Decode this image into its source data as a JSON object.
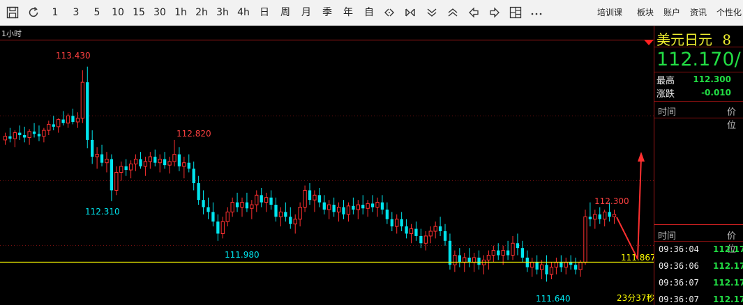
{
  "toolbar": {
    "icons": [
      "chart-save-icon",
      "refresh-icon"
    ],
    "periods": [
      "1",
      "3",
      "5",
      "10",
      "15",
      "30",
      "1h",
      "2h",
      "3h",
      "4h",
      "日",
      "周",
      "月",
      "季",
      "年",
      "自"
    ],
    "right_menu": [
      "培训课",
      "板块",
      "账户",
      "资讯",
      "个性化"
    ]
  },
  "chart": {
    "period_label": "1小时",
    "labels": {
      "high_main": "113.430",
      "high_2": "112.820",
      "low_1": "112.310",
      "low_2": "111.980",
      "recent_high": "112.300",
      "bottom_low": "111.640",
      "current_price": "111.867",
      "countdown": "23分37秒"
    },
    "colors": {
      "up": "#ff3030",
      "down": "#00e5ee",
      "current_line": "#ffff00",
      "grid": "#7a1010"
    }
  },
  "chart_data": {
    "type": "candlestick",
    "title": "",
    "period": "1小时",
    "annotations": [
      {
        "label": "113.430",
        "kind": "high"
      },
      {
        "label": "112.820",
        "kind": "high"
      },
      {
        "label": "112.310",
        "kind": "low"
      },
      {
        "label": "111.980",
        "kind": "low"
      },
      {
        "label": "112.300",
        "kind": "high"
      },
      {
        "label": "111.640",
        "kind": "low"
      }
    ],
    "ylim": [
      111.55,
      113.55
    ],
    "current_price": 111.867,
    "candles": [
      [
        112.82,
        112.88,
        112.78,
        112.85
      ],
      [
        112.85,
        112.92,
        112.8,
        112.83
      ],
      [
        112.83,
        112.9,
        112.76,
        112.88
      ],
      [
        112.88,
        112.94,
        112.82,
        112.86
      ],
      [
        112.86,
        112.93,
        112.8,
        112.84
      ],
      [
        112.84,
        112.91,
        112.78,
        112.89
      ],
      [
        112.89,
        112.96,
        112.84,
        112.87
      ],
      [
        112.87,
        112.94,
        112.81,
        112.85
      ],
      [
        112.85,
        112.92,
        112.8,
        112.9
      ],
      [
        112.9,
        112.98,
        112.86,
        112.95
      ],
      [
        112.95,
        113.02,
        112.9,
        112.93
      ],
      [
        112.93,
        113.0,
        112.88,
        112.99
      ],
      [
        112.99,
        113.06,
        112.94,
        112.96
      ],
      [
        112.96,
        113.04,
        112.92,
        113.02
      ],
      [
        113.02,
        113.08,
        112.95,
        112.97
      ],
      [
        112.97,
        113.05,
        112.92,
        113.0
      ],
      [
        113.0,
        113.4,
        112.96,
        113.3
      ],
      [
        113.3,
        113.43,
        112.75,
        112.82
      ],
      [
        112.82,
        112.9,
        112.62,
        112.68
      ],
      [
        112.68,
        112.76,
        112.58,
        112.7
      ],
      [
        112.7,
        112.78,
        112.6,
        112.63
      ],
      [
        112.63,
        112.72,
        112.55,
        112.66
      ],
      [
        112.66,
        112.7,
        112.31,
        112.4
      ],
      [
        112.4,
        112.6,
        112.36,
        112.55
      ],
      [
        112.55,
        112.64,
        112.48,
        112.6
      ],
      [
        112.6,
        112.66,
        112.52,
        112.57
      ],
      [
        112.57,
        112.65,
        112.5,
        112.62
      ],
      [
        112.62,
        112.7,
        112.56,
        112.66
      ],
      [
        112.66,
        112.72,
        112.58,
        112.6
      ],
      [
        112.6,
        112.68,
        112.52,
        112.64
      ],
      [
        112.64,
        112.72,
        112.58,
        112.68
      ],
      [
        112.68,
        112.74,
        112.6,
        112.63
      ],
      [
        112.63,
        112.7,
        112.55,
        112.66
      ],
      [
        112.66,
        112.72,
        112.58,
        112.61
      ],
      [
        112.61,
        112.68,
        112.54,
        112.64
      ],
      [
        112.64,
        112.82,
        112.6,
        112.7
      ],
      [
        112.7,
        112.76,
        112.56,
        112.6
      ],
      [
        112.6,
        112.68,
        112.5,
        112.63
      ],
      [
        112.63,
        112.7,
        112.55,
        112.58
      ],
      [
        112.58,
        112.64,
        112.4,
        112.46
      ],
      [
        112.46,
        112.52,
        112.28,
        112.32
      ],
      [
        112.32,
        112.4,
        112.2,
        112.26
      ],
      [
        112.26,
        112.34,
        112.16,
        112.22
      ],
      [
        112.22,
        112.3,
        112.1,
        112.14
      ],
      [
        112.14,
        112.2,
        111.98,
        112.04
      ],
      [
        112.04,
        112.18,
        112.0,
        112.14
      ],
      [
        112.14,
        112.26,
        112.1,
        112.22
      ],
      [
        112.22,
        112.34,
        112.18,
        112.3
      ],
      [
        112.3,
        112.38,
        112.22,
        112.26
      ],
      [
        112.26,
        112.34,
        112.18,
        112.3
      ],
      [
        112.3,
        112.38,
        112.22,
        112.25
      ],
      [
        112.25,
        112.32,
        112.16,
        112.28
      ],
      [
        112.28,
        112.4,
        112.22,
        112.36
      ],
      [
        112.36,
        112.42,
        112.26,
        112.3
      ],
      [
        112.3,
        112.38,
        112.22,
        112.34
      ],
      [
        112.34,
        112.4,
        112.24,
        112.28
      ],
      [
        112.28,
        112.34,
        112.14,
        112.18
      ],
      [
        112.18,
        112.26,
        112.1,
        112.22
      ],
      [
        112.22,
        112.3,
        112.14,
        112.18
      ],
      [
        112.18,
        112.26,
        112.08,
        112.12
      ],
      [
        112.12,
        112.2,
        112.04,
        112.16
      ],
      [
        112.16,
        112.3,
        112.1,
        112.26
      ],
      [
        112.26,
        112.44,
        112.22,
        112.4
      ],
      [
        112.4,
        112.46,
        112.28,
        112.32
      ],
      [
        112.32,
        112.4,
        112.22,
        112.36
      ],
      [
        112.36,
        112.42,
        112.26,
        112.3
      ],
      [
        112.3,
        112.36,
        112.2,
        112.24
      ],
      [
        112.24,
        112.32,
        112.16,
        112.28
      ],
      [
        112.28,
        112.34,
        112.18,
        112.22
      ],
      [
        112.22,
        112.3,
        112.14,
        112.26
      ],
      [
        112.26,
        112.32,
        112.16,
        112.2
      ],
      [
        112.2,
        112.3,
        112.14,
        112.27
      ],
      [
        112.27,
        112.34,
        112.2,
        112.24
      ],
      [
        112.24,
        112.32,
        112.16,
        112.28
      ],
      [
        112.28,
        112.36,
        112.2,
        112.25
      ],
      [
        112.25,
        112.32,
        112.18,
        112.29
      ],
      [
        112.29,
        112.36,
        112.22,
        112.26
      ],
      [
        112.26,
        112.34,
        112.18,
        112.3
      ],
      [
        112.3,
        112.36,
        112.2,
        112.24
      ],
      [
        112.24,
        112.3,
        112.12,
        112.16
      ],
      [
        112.16,
        112.22,
        112.06,
        112.1
      ],
      [
        112.1,
        112.2,
        112.04,
        112.16
      ],
      [
        112.16,
        112.22,
        112.06,
        112.1
      ],
      [
        112.1,
        112.16,
        112.0,
        112.04
      ],
      [
        112.04,
        112.12,
        111.96,
        112.08
      ],
      [
        112.08,
        112.14,
        111.98,
        112.02
      ],
      [
        112.02,
        112.08,
        111.92,
        111.96
      ],
      [
        111.96,
        112.06,
        111.9,
        112.02
      ],
      [
        112.02,
        112.1,
        111.96,
        112.06
      ],
      [
        112.06,
        112.14,
        112.0,
        112.1
      ],
      [
        112.1,
        112.18,
        112.02,
        112.06
      ],
      [
        112.06,
        112.12,
        111.94,
        111.98
      ],
      [
        111.98,
        112.04,
        111.74,
        111.78
      ],
      [
        111.78,
        111.9,
        111.72,
        111.86
      ],
      [
        111.86,
        111.92,
        111.76,
        111.8
      ],
      [
        111.8,
        111.88,
        111.72,
        111.84
      ],
      [
        111.84,
        111.92,
        111.76,
        111.8
      ],
      [
        111.8,
        111.88,
        111.72,
        111.84
      ],
      [
        111.84,
        111.9,
        111.74,
        111.78
      ],
      [
        111.78,
        111.86,
        111.7,
        111.82
      ],
      [
        111.82,
        111.9,
        111.74,
        111.86
      ],
      [
        111.86,
        111.94,
        111.8,
        111.9
      ],
      [
        111.9,
        111.96,
        111.82,
        111.86
      ],
      [
        111.86,
        111.94,
        111.78,
        111.9
      ],
      [
        111.9,
        111.98,
        111.82,
        111.86
      ],
      [
        111.86,
        112.02,
        111.82,
        111.96
      ],
      [
        111.96,
        112.04,
        111.86,
        111.92
      ],
      [
        111.92,
        111.98,
        111.8,
        111.84
      ],
      [
        111.84,
        111.9,
        111.72,
        111.76
      ],
      [
        111.76,
        111.84,
        111.68,
        111.8
      ],
      [
        111.8,
        111.86,
        111.7,
        111.74
      ],
      [
        111.74,
        111.82,
        111.66,
        111.78
      ],
      [
        111.78,
        111.86,
        111.64,
        111.7
      ],
      [
        111.7,
        111.8,
        111.66,
        111.76
      ],
      [
        111.76,
        111.84,
        111.7,
        111.8
      ],
      [
        111.8,
        111.86,
        111.72,
        111.76
      ],
      [
        111.76,
        111.84,
        111.7,
        111.8
      ],
      [
        111.8,
        111.86,
        111.74,
        111.78
      ],
      [
        111.78,
        111.84,
        111.7,
        111.74
      ],
      [
        111.74,
        111.82,
        111.68,
        111.8
      ],
      [
        111.8,
        112.24,
        111.78,
        112.18
      ],
      [
        112.18,
        112.3,
        112.1,
        112.16
      ],
      [
        112.16,
        112.24,
        112.08,
        112.2
      ],
      [
        112.2,
        112.26,
        112.12,
        112.16
      ],
      [
        112.16,
        112.24,
        112.1,
        112.22
      ],
      [
        112.22,
        112.3,
        112.14,
        112.18
      ],
      [
        112.18,
        112.24,
        112.12,
        112.2
      ]
    ]
  },
  "panel": {
    "symbol": "美元日元",
    "code": "8",
    "price": "112.170/",
    "stats": [
      {
        "label": "最高",
        "value": "112.300",
        "color": "#22dd44"
      },
      {
        "label": "涨跌",
        "value": "-0.010",
        "color": "#22dd44"
      }
    ],
    "headers": {
      "time": "时间",
      "price": "价位"
    },
    "ticks": [
      {
        "time": "09:36:04",
        "price": "112.170"
      },
      {
        "time": "09:36:06",
        "price": "112.170"
      },
      {
        "time": "09:36:07",
        "price": "112.170"
      },
      {
        "time": "09:36:07",
        "price": "112.170"
      }
    ]
  }
}
